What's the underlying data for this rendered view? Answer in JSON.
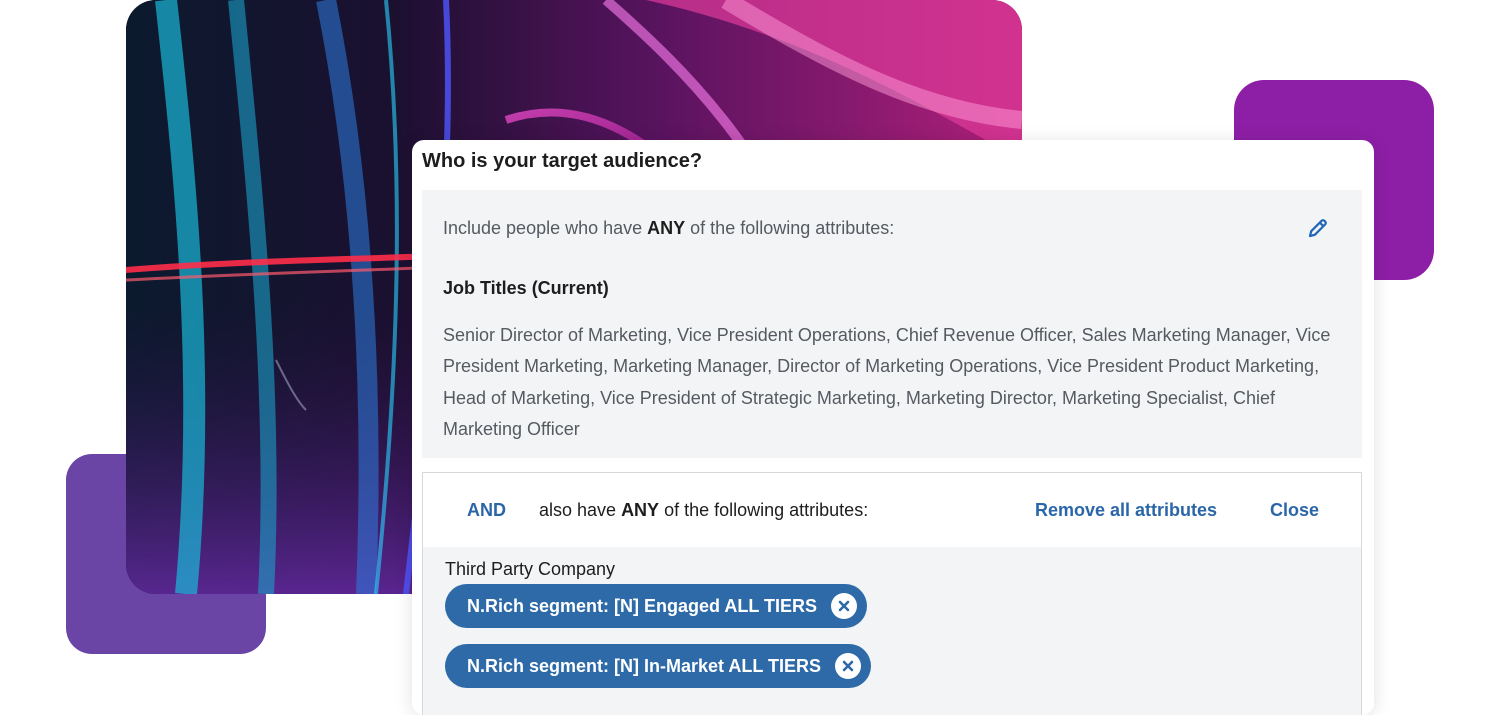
{
  "card": {
    "title": "Who is your target audience?"
  },
  "include": {
    "prefix": "Include people who have ",
    "emphasis": "ANY",
    "suffix": " of the following attributes:",
    "edit_icon": "pencil-icon"
  },
  "job_titles": {
    "heading": "Job Titles (Current)",
    "values": "Senior Director of Marketing, Vice President Operations, Chief Revenue Officer, Sales Marketing Manager, Vice President Marketing, Marketing Manager, Director of Marketing Operations, Vice President Product Marketing, Head of Marketing, Vice President of Strategic Marketing, Marketing Director, Marketing Specialist, Chief Marketing Officer"
  },
  "and_section": {
    "and_label": "AND",
    "text_prefix": "also have ",
    "text_emphasis": "ANY",
    "text_suffix": " of the following attributes:",
    "remove_all_label": "Remove all attributes",
    "close_label": "Close",
    "group_label": "Third Party Company",
    "chips": [
      {
        "label": "N.Rich segment: [N] Engaged ALL TIERS",
        "remove_icon": "close-circle-icon"
      },
      {
        "label": "N.Rich segment: [N] In-Market ALL TIERS",
        "remove_icon": "close-circle-icon"
      }
    ]
  },
  "colors": {
    "accent": "#2d6aa7",
    "deco_left": "#6a45a6",
    "deco_right": "#8d1fa6"
  }
}
